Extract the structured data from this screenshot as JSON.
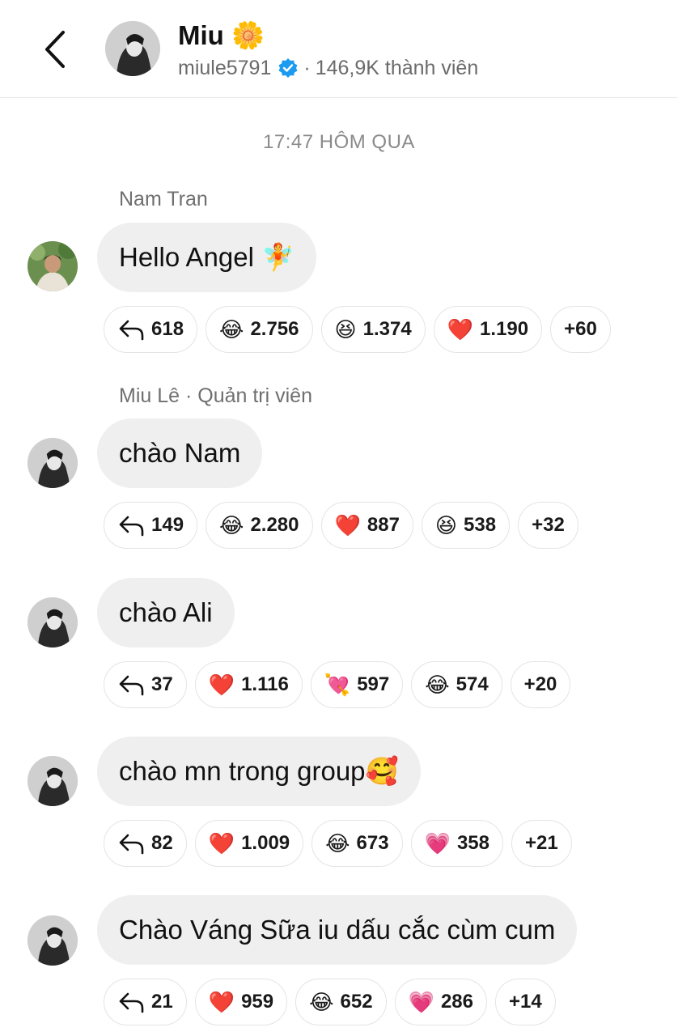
{
  "header": {
    "title": "Miu 🌼",
    "username": "miule5791",
    "separator": "·",
    "members": "146,9K thành viên"
  },
  "timestamp": "17:47 HÔM QUA",
  "messages": [
    {
      "sender": "Nam Tran",
      "text": "Hello Angel 🧚",
      "reactions": [
        {
          "icon": "reply-icon",
          "emoji": "",
          "count": "618"
        },
        {
          "icon": "tears-of-joy-emoji",
          "emoji": "😂",
          "count": "2.756"
        },
        {
          "icon": "grinning-squint-emoji",
          "emoji": "😆",
          "count": "1.374"
        },
        {
          "icon": "red-heart-emoji",
          "emoji": "❤️",
          "count": "1.190"
        },
        {
          "icon": "",
          "emoji": "",
          "count": "+60"
        }
      ]
    },
    {
      "sender": "Miu Lê · Quản trị viên",
      "text": "chào Nam",
      "reactions": [
        {
          "icon": "reply-icon",
          "emoji": "",
          "count": "149"
        },
        {
          "icon": "tears-of-joy-emoji",
          "emoji": "😂",
          "count": "2.280"
        },
        {
          "icon": "red-heart-emoji",
          "emoji": "❤️",
          "count": "887"
        },
        {
          "icon": "grinning-squint-emoji",
          "emoji": "😆",
          "count": "538"
        },
        {
          "icon": "",
          "emoji": "",
          "count": "+32"
        }
      ]
    },
    {
      "sender": "",
      "text": "chào Ali",
      "reactions": [
        {
          "icon": "reply-icon",
          "emoji": "",
          "count": "37"
        },
        {
          "icon": "red-heart-emoji",
          "emoji": "❤️",
          "count": "1.116"
        },
        {
          "icon": "heart-with-arrow-emoji",
          "emoji": "💘",
          "count": "597"
        },
        {
          "icon": "tears-of-joy-emoji",
          "emoji": "😂",
          "count": "574"
        },
        {
          "icon": "",
          "emoji": "",
          "count": "+20"
        }
      ]
    },
    {
      "sender": "",
      "text": "chào mn trong group🥰",
      "reactions": [
        {
          "icon": "reply-icon",
          "emoji": "",
          "count": "82"
        },
        {
          "icon": "red-heart-emoji",
          "emoji": "❤️",
          "count": "1.009"
        },
        {
          "icon": "tears-of-joy-emoji",
          "emoji": "😂",
          "count": "673"
        },
        {
          "icon": "growing-heart-emoji",
          "emoji": "💗",
          "count": "358"
        },
        {
          "icon": "",
          "emoji": "",
          "count": "+21"
        }
      ]
    },
    {
      "sender": "",
      "text": "Chào Váng Sữa iu dấu cắc cùm cum",
      "reactions": [
        {
          "icon": "reply-icon",
          "emoji": "",
          "count": "21"
        },
        {
          "icon": "red-heart-emoji",
          "emoji": "❤️",
          "count": "959"
        },
        {
          "icon": "tears-of-joy-emoji",
          "emoji": "😂",
          "count": "652"
        },
        {
          "icon": "growing-heart-emoji",
          "emoji": "💗",
          "count": "286"
        },
        {
          "icon": "",
          "emoji": "",
          "count": "+14"
        }
      ]
    }
  ],
  "colors": {
    "verified": "#1d9bf0",
    "bubble": "#efefef",
    "muted_text": "#6f6f6f"
  }
}
